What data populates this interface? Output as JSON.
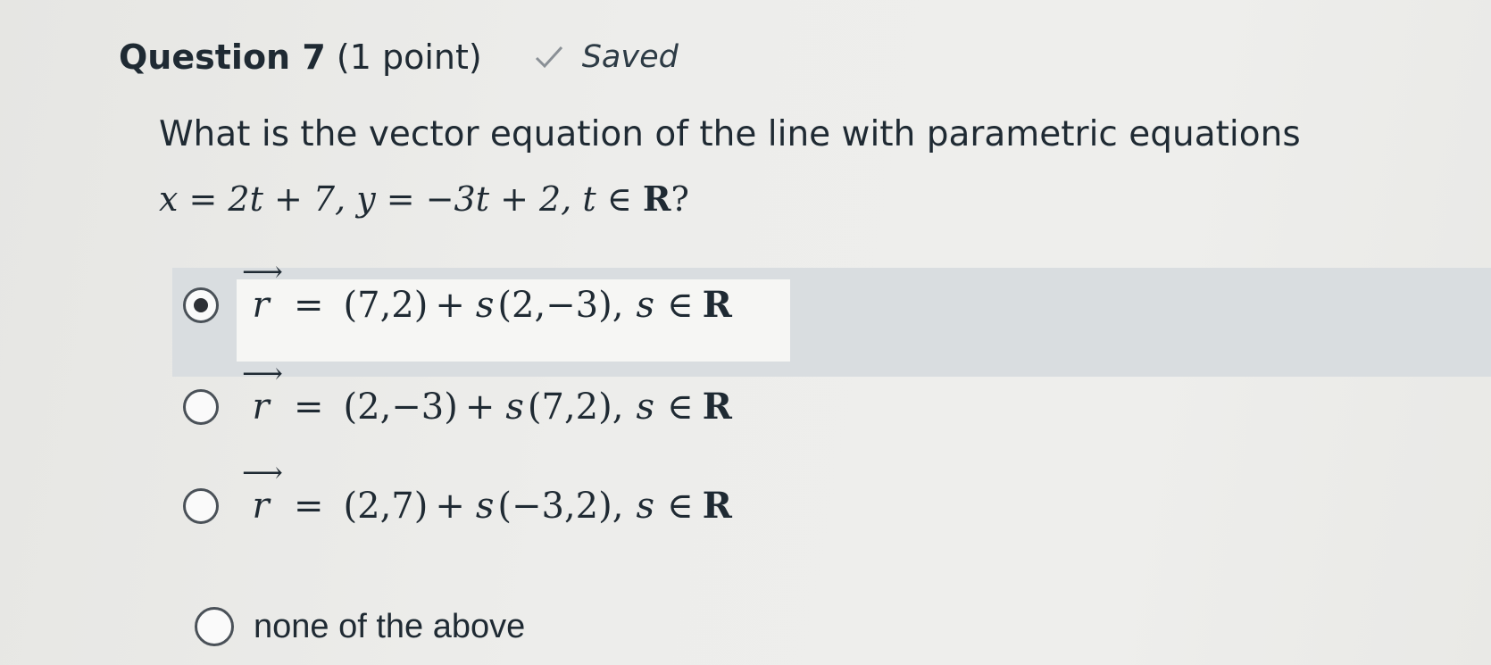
{
  "question": {
    "number_label": "Question 7",
    "points_label": "(1 point)",
    "saved_label": "Saved",
    "prompt": "What is the vector equation of the line with parametric equations",
    "parametric": {
      "x_eq": "x = 2t + 7,",
      "y_eq": "y = −3t + 2,",
      "t_domain_prefix": "t ∈",
      "set": "R",
      "question_mark": "?"
    }
  },
  "options": [
    {
      "selected": true,
      "vector": "r",
      "point": "(7,2)",
      "direction": "(2,−3)",
      "param": "s",
      "domain": "∈",
      "set": "R"
    },
    {
      "selected": false,
      "vector": "r",
      "point": "(2,−3)",
      "direction": "(7,2)",
      "param": "s",
      "domain": "∈",
      "set": "R"
    },
    {
      "selected": false,
      "vector": "r",
      "point": "(2,7)",
      "direction": "(−3,2)",
      "param": "s",
      "domain": "∈",
      "set": "R"
    },
    {
      "selected": false,
      "text": "none of the above"
    }
  ],
  "symbols": {
    "equals": "=",
    "plus": "+",
    "comma": ","
  },
  "icons": {
    "saved": "check-icon"
  },
  "colors": {
    "highlight": "#d9dde0",
    "text": "#1f2a33"
  }
}
